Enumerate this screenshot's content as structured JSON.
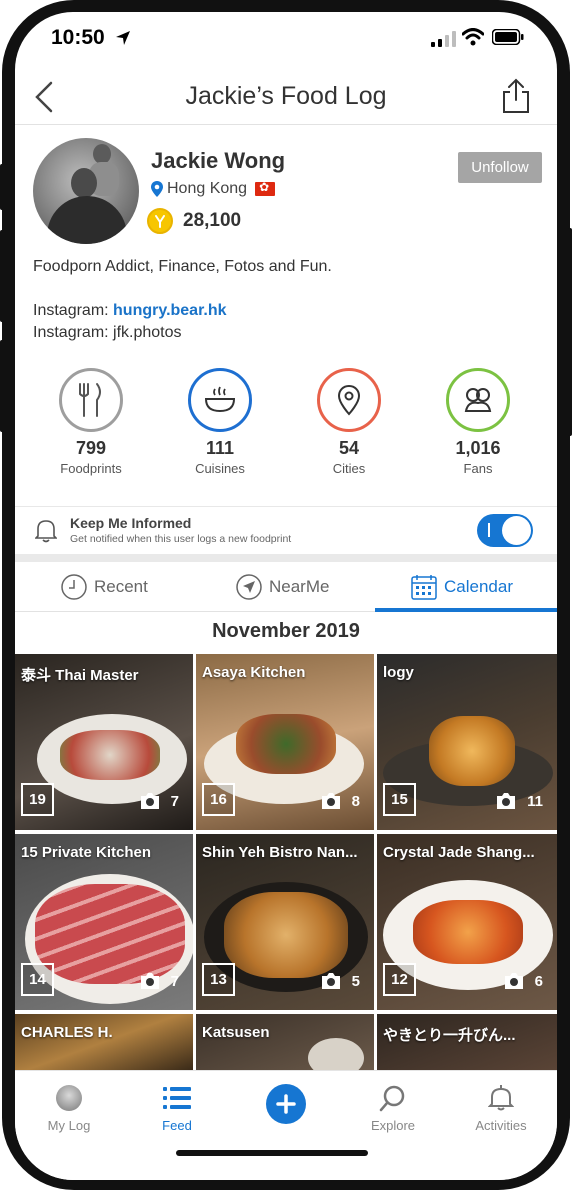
{
  "status_bar": {
    "time": "10:50"
  },
  "nav": {
    "title": "Jackie’s Food Log"
  },
  "profile": {
    "name": "Jackie Wong",
    "location": "Hong Kong",
    "points": "28,100",
    "follow_button": "Unfollow",
    "bio": "Foodporn Addict, Finance, Fotos and Fun.",
    "instagram_label_1": "Instagram: ",
    "instagram_handle_1": "hungry.bear.hk",
    "instagram_line_2": "Instagram: jfk.photos"
  },
  "stats": [
    {
      "value": "799",
      "label": "Foodprints",
      "color": "#9e9e9e",
      "icon": "fork-knife-icon"
    },
    {
      "value": "111",
      "label": "Cuisines",
      "color": "#1e6fd1",
      "icon": "bowl-icon"
    },
    {
      "value": "54",
      "label": "Cities",
      "color": "#e8624a",
      "icon": "map-pin-icon"
    },
    {
      "value": "1,016",
      "label": "Fans",
      "color": "#7cc242",
      "icon": "fans-icon"
    }
  ],
  "notify": {
    "title": "Keep Me Informed",
    "subtitle": "Get notified when this user logs a new foodprint",
    "enabled": true
  },
  "tabs": [
    {
      "label": "Recent",
      "icon": "clock-icon",
      "active": false
    },
    {
      "label": "NearMe",
      "icon": "navigation-arrow-icon",
      "active": false
    },
    {
      "label": "Calendar",
      "icon": "calendar-icon",
      "active": true
    }
  ],
  "month": "November 2019",
  "tiles": [
    {
      "name": "泰斗 Thai Master",
      "day": "19",
      "photos": "7"
    },
    {
      "name": "Asaya Kitchen",
      "day": "16",
      "photos": "8"
    },
    {
      "name": "logy",
      "day": "15",
      "photos": "11"
    },
    {
      "name": "15 Private Kitchen",
      "day": "14",
      "photos": "7"
    },
    {
      "name": "Shin Yeh Bistro Nan...",
      "day": "13",
      "photos": "5"
    },
    {
      "name": "Crystal Jade Shang...",
      "day": "12",
      "photos": "6"
    },
    {
      "name": "CHARLES H.",
      "day": "",
      "photos": ""
    },
    {
      "name": "Katsusen",
      "day": "",
      "photos": ""
    },
    {
      "name": "やきとり一升びん...",
      "day": "",
      "photos": ""
    }
  ],
  "bottom_nav": [
    {
      "label": "My Log",
      "active": false
    },
    {
      "label": "Feed",
      "active": true
    },
    {
      "label": "Explore",
      "active": false
    },
    {
      "label": "Activities",
      "active": false
    }
  ],
  "colors": {
    "accent": "#1676d2",
    "unfollow_bg": "#a5a5a5"
  }
}
